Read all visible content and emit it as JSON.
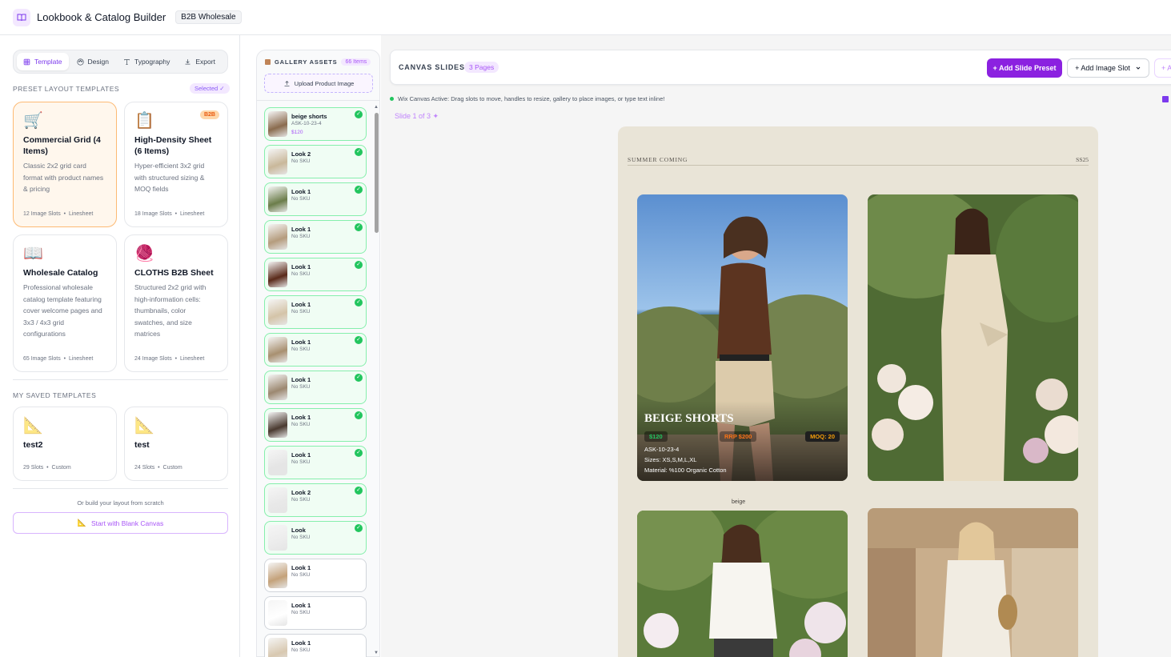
{
  "header": {
    "title": "Lookbook & Catalog Builder",
    "badge": "B2B Wholesale"
  },
  "left_panel": {
    "tabs": [
      {
        "label": "Template",
        "icon": "grid-icon",
        "active": true
      },
      {
        "label": "Design",
        "icon": "palette-icon",
        "active": false
      },
      {
        "label": "Typography",
        "icon": "type-icon",
        "active": false
      },
      {
        "label": "Export",
        "icon": "download-icon",
        "active": false
      }
    ],
    "preset_label": "PRESET LAYOUT TEMPLATES",
    "selected_pill": "Selected ✓",
    "presets": [
      {
        "icon": "🛒",
        "title": "Commercial Grid (4 Items)",
        "desc": "Classic 2x2 grid card format with product names & pricing",
        "slots": "12 Image Slots",
        "kind": "Linesheet",
        "selected": true,
        "tag": ""
      },
      {
        "icon": "📋",
        "title": "High-Density Sheet (6 Items)",
        "desc": "Hyper-efficient 3x2 grid with structured sizing & MOQ fields",
        "slots": "18 Image Slots",
        "kind": "Linesheet",
        "selected": false,
        "tag": "B2B"
      },
      {
        "icon": "📖",
        "title": "Wholesale Catalog",
        "desc": "Professional wholesale catalog template featuring cover welcome pages and 3x3 / 4x3 grid configurations",
        "slots": "65 Image Slots",
        "kind": "Linesheet",
        "selected": false,
        "tag": ""
      },
      {
        "icon": "🧶",
        "title": "CLOTHS B2B Sheet",
        "desc": "Structured 2x2 grid with high-information cells: thumbnails, color swatches, and size matrices",
        "slots": "24 Image Slots",
        "kind": "Linesheet",
        "selected": false,
        "tag": ""
      }
    ],
    "saved_label": "MY SAVED TEMPLATES",
    "saved": [
      {
        "icon": "📐",
        "title": "test2",
        "slots": "29 Slots",
        "kind": "Custom"
      },
      {
        "icon": "📐",
        "title": "test",
        "slots": "24 Slots",
        "kind": "Custom"
      }
    ],
    "scratch_text": "Or build your layout from scratch",
    "blank_button": "Start with Blank Canvas"
  },
  "gallery": {
    "title": "GALLERY ASSETS",
    "count": "66 Items",
    "upload_label": "Upload Product Image",
    "items": [
      {
        "name": "beige shorts",
        "sku": "ASK-10-23-4",
        "price": "$120",
        "placed": true,
        "thumb": "#8a6b4e"
      },
      {
        "name": "Look 2",
        "sku": "No SKU",
        "price": "",
        "placed": true,
        "thumb": "#c9b89a"
      },
      {
        "name": "Look 1",
        "sku": "No SKU",
        "price": "",
        "placed": true,
        "thumb": "#6b7d4a"
      },
      {
        "name": "Look 1",
        "sku": "No SKU",
        "price": "",
        "placed": true,
        "thumb": "#b59c7d"
      },
      {
        "name": "Look 1",
        "sku": "No SKU",
        "price": "",
        "placed": true,
        "thumb": "#5a2a1a"
      },
      {
        "name": "Look 1",
        "sku": "No SKU",
        "price": "",
        "placed": true,
        "thumb": "#d4c4a8"
      },
      {
        "name": "Look 1",
        "sku": "No SKU",
        "price": "",
        "placed": true,
        "thumb": "#a89070"
      },
      {
        "name": "Look 1",
        "sku": "No SKU",
        "price": "",
        "placed": true,
        "thumb": "#9c8870"
      },
      {
        "name": "Look 1",
        "sku": "No SKU",
        "price": "",
        "placed": true,
        "thumb": "#4a3a30"
      },
      {
        "name": "Look 1",
        "sku": "No SKU",
        "price": "",
        "placed": true,
        "thumb": "#e5e5e5"
      },
      {
        "name": "Look 2",
        "sku": "No SKU",
        "price": "",
        "placed": true,
        "thumb": "#e8e8e8"
      },
      {
        "name": "Look",
        "sku": "No SKU",
        "price": "",
        "placed": true,
        "thumb": "#ececec"
      },
      {
        "name": "Look 1",
        "sku": "No SKU",
        "price": "",
        "placed": false,
        "thumb": "#c4a27a"
      },
      {
        "name": "Look 1",
        "sku": "No SKU",
        "price": "",
        "placed": false,
        "thumb": "#ffffff"
      },
      {
        "name": "Look 1",
        "sku": "No SKU",
        "price": "",
        "placed": false,
        "thumb": "#d8c8b0"
      }
    ]
  },
  "canvas": {
    "label": "CANVAS SLIDES:",
    "pages": "3 Pages",
    "add_preset": "+ Add Slide Preset",
    "add_slot": "+ Add Image Slot",
    "more": "+ A",
    "status": "Wix Canvas Active: Drag slots to move, handles to resize, gallery to place images, or type text inline!",
    "slide_indicator": "Slide 1 of 3 ✦"
  },
  "slide": {
    "title": "SUMMER COMING",
    "season": "SS25",
    "caption": "beige",
    "product": {
      "name": "BEIGE SHORTS",
      "price": "$120",
      "rrp": "RRP $200",
      "moq": "MOQ: 20",
      "sku": "ASK-10-23-4",
      "sizes": "Sizes: XS,S,M,L,XL",
      "material": "Material: %100 Organic Cotton"
    }
  },
  "colors": {
    "accent": "#8b21e0",
    "placed_green": "#22c55e",
    "slide_bg": "#e9e4d7"
  }
}
